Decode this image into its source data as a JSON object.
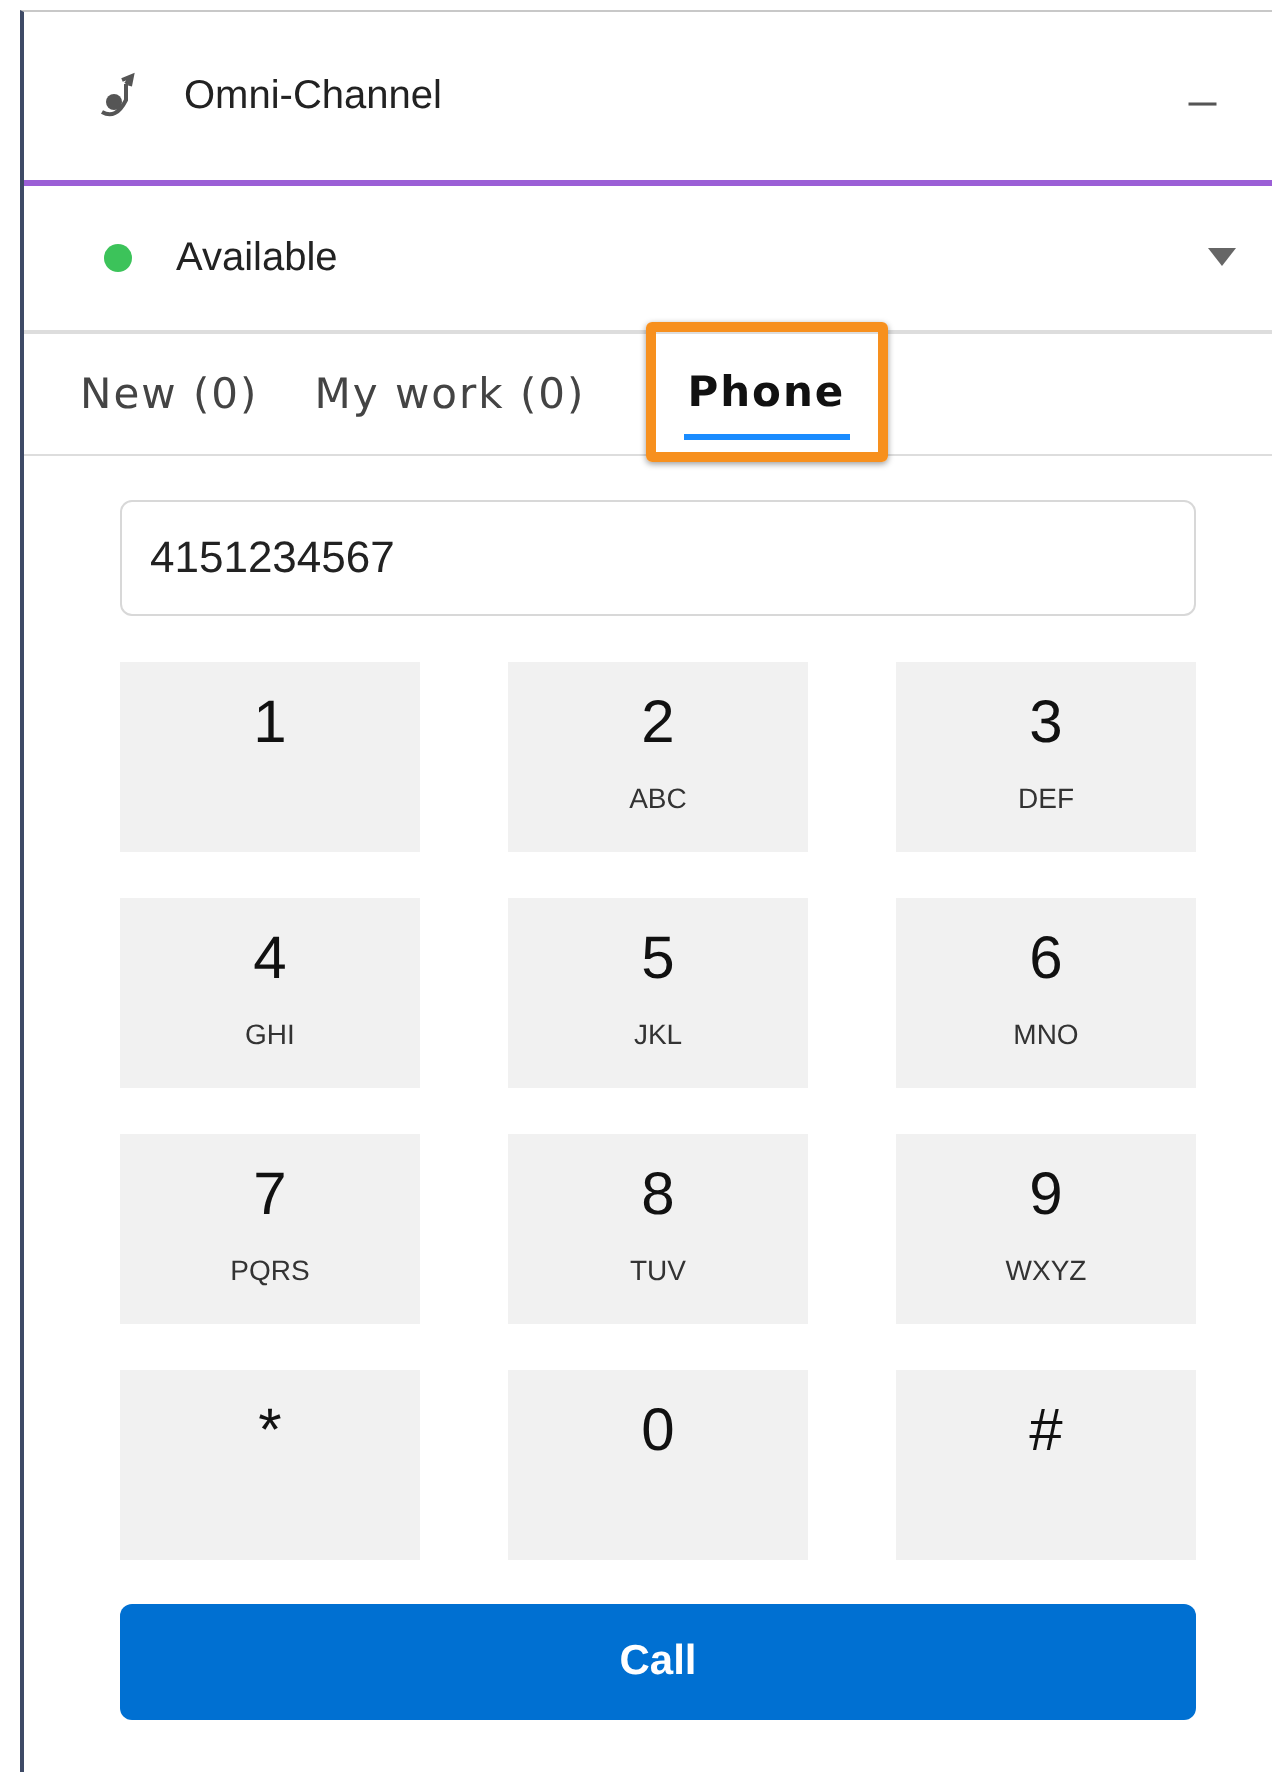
{
  "header": {
    "title": "Omni-Channel",
    "minimize": "_"
  },
  "status": {
    "label": "Available",
    "color": "#3cc35a"
  },
  "tabs": [
    {
      "label": "New (0)",
      "selected": false,
      "highlighted": false
    },
    {
      "label": "My work (0)",
      "selected": false,
      "highlighted": false
    },
    {
      "label": "Phone",
      "selected": true,
      "highlighted": true
    }
  ],
  "number_field": {
    "value": "4151234567"
  },
  "keys": [
    {
      "digit": "1"
    },
    {
      "digit": "2",
      "letters": "ABC"
    },
    {
      "digit": "3",
      "letters": "DEF"
    },
    {
      "digit": "4",
      "letters": "GHI"
    },
    {
      "digit": "5",
      "letters": "JKL"
    },
    {
      "digit": "6",
      "letters": "MNO"
    },
    {
      "digit": "7",
      "letters": "PQRS"
    },
    {
      "digit": "8",
      "letters": "TUV"
    },
    {
      "digit": "9",
      "letters": "WXYZ"
    },
    {
      "digit": "*"
    },
    {
      "digit": "0"
    },
    {
      "digit": "#"
    }
  ],
  "call_button": "Call"
}
